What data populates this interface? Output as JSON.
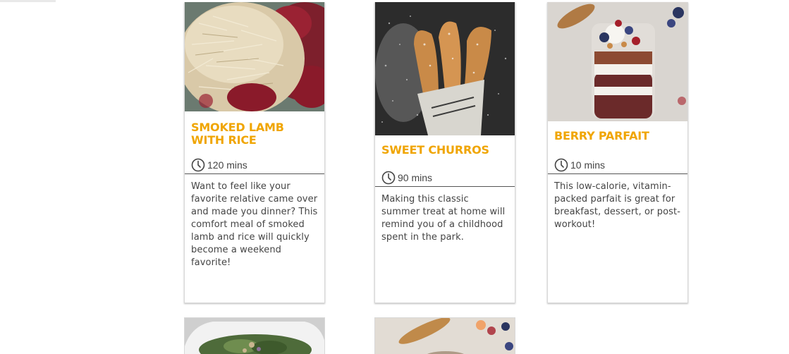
{
  "recipes": [
    {
      "title": "SMOKED LAMB WITH RICE",
      "time": "120 mins",
      "description": "Want to feel like your favorite relative came over and made you dinner? This comfort meal of smoked lamb and rice will quickly become a weekend favorite!"
    },
    {
      "title": "SWEET CHURROS",
      "time": "90 mins",
      "description": "Making this classic summer treat at home will remind you of a childhood spent in the park."
    },
    {
      "title": "BERRY PARFAIT",
      "time": "10 mins",
      "description": "This low-calorie, vitamin-packed parfait is great for breakfast, dessert, or post-workout!"
    }
  ],
  "icons": {
    "time": "clock-icon"
  },
  "colors": {
    "title_accent": "#f0a500",
    "text": "#444444"
  }
}
